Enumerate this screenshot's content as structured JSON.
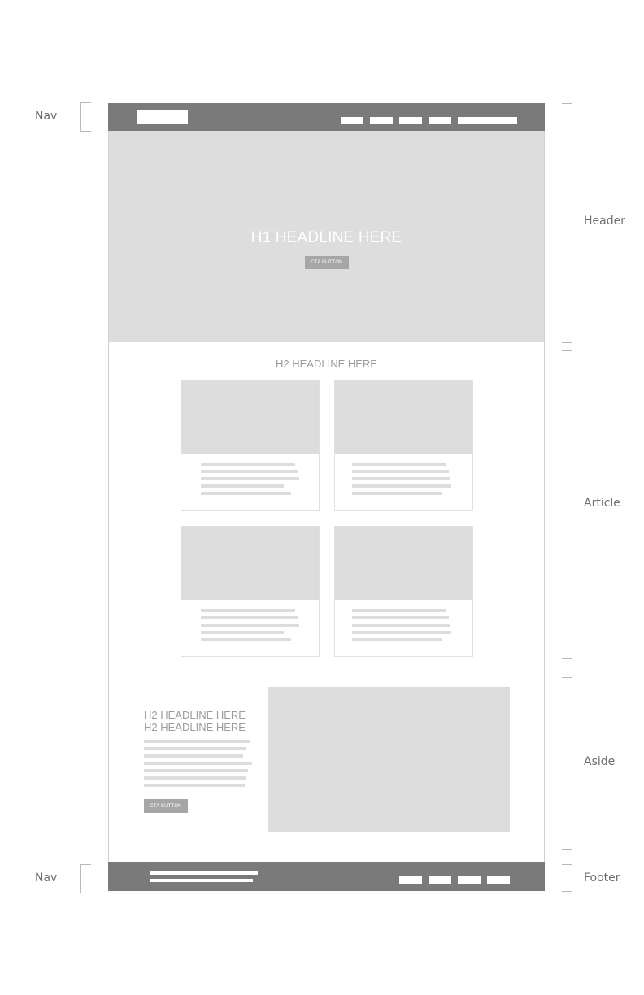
{
  "labels": {
    "nav_top": "Nav",
    "header": "Header",
    "article": "Article",
    "aside": "Aside",
    "nav_bottom": "Nav",
    "footer": "Footer"
  },
  "hero": {
    "headline": "H1 HEADLINE HERE",
    "cta": "CTA BUTTON"
  },
  "article": {
    "headline": "H2 HEADLINE HERE"
  },
  "aside": {
    "headline_line1": "H2 HEADLINE HERE",
    "headline_line2": "H2 HEADLINE HERE",
    "cta": "CTA BUTTON"
  },
  "colors": {
    "nav": "#7a7a7a",
    "placeholder": "#dddddd",
    "button": "#a6a6a6"
  }
}
